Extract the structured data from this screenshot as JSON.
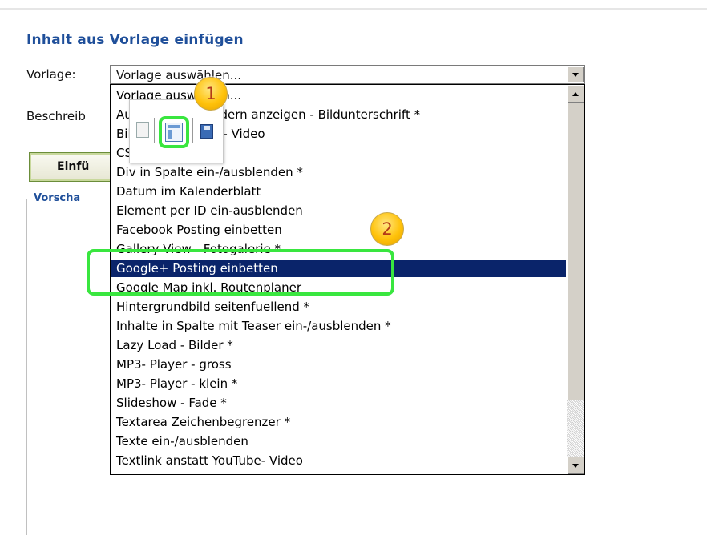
{
  "page": {
    "title": "Inhalt aus Vorlage einfügen",
    "vorlage_label": "Vorlage:",
    "beschreibung_label": "Beschreib",
    "insert_button_label": "Einfü",
    "preview_legend": "Vorscha"
  },
  "select": {
    "value": "Vorlage auswählen..."
  },
  "dropdown": {
    "selected_index": 9,
    "options": [
      "Vorlage auswählen...",
      "Ausgewählten Bildern anzeigen - Bildunterschrift *",
      "Bild statt YouTube- Video",
      "CSS- Slideshow *",
      "Div in Spalte ein-/ausblenden *",
      "Datum im Kalenderblatt",
      "Element per ID ein-ausblenden",
      "Facebook Posting einbetten",
      "Gallery View - Fotogalerie *",
      "Google+ Posting einbetten",
      "Google Map inkl. Routenplaner",
      "Hintergrundbild seitenfuellend *",
      "Inhalte in Spalte mit Teaser ein-/ausblenden *",
      "Lazy Load - Bilder *",
      "MP3- Player - gross",
      "MP3- Player - klein *",
      "Slideshow - Fade *",
      "Textarea Zeichenbegrenzer *",
      "Texte ein-/ausblenden",
      "Textlink anstatt YouTube- Video"
    ]
  },
  "annotations": {
    "badge_1": "1",
    "badge_2": "2",
    "highlight_color": "#39e63f",
    "badge_color": "#ffc20a"
  },
  "icons": {
    "toolbar_left": "template-icon",
    "toolbar_middle": "layout-icon",
    "toolbar_right": "save-icon"
  },
  "colors": {
    "title": "#1f4f9a",
    "selected_option_bg": "#0a246a"
  }
}
